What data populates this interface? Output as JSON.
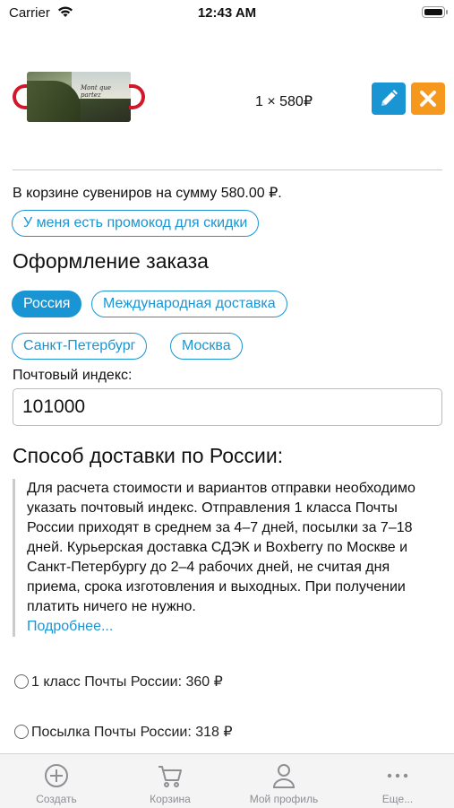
{
  "status_bar": {
    "carrier": "Carrier",
    "time": "12:43 AM"
  },
  "cart_item": {
    "image_caption": "Mont que partez",
    "quantity_price": "1 × 580₽"
  },
  "cart_summary": "В корзине сувениров на сумму 580.00 ₽.",
  "promo_button": "У меня есть промокод для скидки",
  "order_title": "Оформление заказа",
  "region_options": [
    {
      "label": "Россия",
      "active": true
    },
    {
      "label": "Международная доставка",
      "active": false
    }
  ],
  "city_options": [
    {
      "label": "Санкт-Петербург"
    },
    {
      "label": "Москва"
    }
  ],
  "zip": {
    "label": "Почтовый индекс:",
    "value": "101000"
  },
  "delivery": {
    "title": "Способ доставки по России:",
    "info": "Для расчета стоимости и вариантов отправки необходимо указать почтовый индекс. Отправления 1 класса Почты России приходят в среднем за 4–7 дней, посылки за 7–18 дней. Курьерская доставка СДЭК и Boxberry по Москве и Санкт-Петербургу до 2–4 рабочих дней, не считая дня приема, срока изготовления и выходных. При получении платить ничего не нужно.",
    "more_link": "Подробнее...",
    "options": [
      {
        "label": "1 класс Почты России: 360 ₽"
      },
      {
        "label": "Посылка Почты России: 318 ₽"
      }
    ]
  },
  "tabbar": [
    {
      "label": "Создать",
      "icon": "plus-circle-icon"
    },
    {
      "label": "Корзина",
      "icon": "cart-icon"
    },
    {
      "label": "Мой профиль",
      "icon": "person-icon"
    },
    {
      "label": "Еще...",
      "icon": "more-icon"
    }
  ],
  "colors": {
    "accent": "#1a95d4",
    "remove": "#f5981d",
    "mug_handle": "#d0182a"
  }
}
